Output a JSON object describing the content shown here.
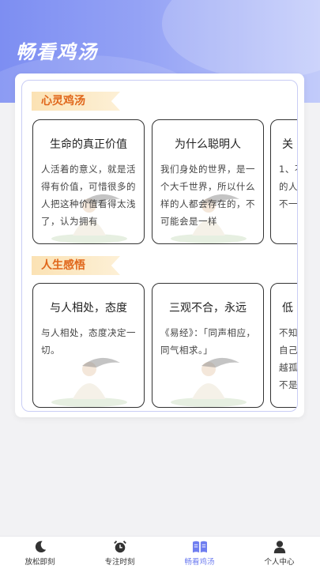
{
  "page": {
    "title": "畅看鸡汤"
  },
  "sections": [
    {
      "tag": "心灵鸡汤",
      "cards": [
        {
          "title": "生命的真正价值",
          "body": "人活着的意义，就是活得有价值，可惜很多的人把这种价值看得太浅了，认为拥有"
        },
        {
          "title": "为什么聪明人",
          "body": "我们身处的世界，是一个大千世界，所以什么样的人都会存在的，不可能会是一样"
        },
        {
          "title": "关",
          "body": "1、不\n的人\n不一"
        }
      ]
    },
    {
      "tag": "人生感悟",
      "cards": [
        {
          "title": "与人相处，态度",
          "body": "与人相处，态度决定一切。"
        },
        {
          "title": "三观不合，永远",
          "body": "《易经》：「同声相应，同气相求。」"
        },
        {
          "title": "低",
          "body": "不知\n自己\n越孤\n不是"
        }
      ]
    }
  ],
  "tabbar": {
    "items": [
      {
        "label": "放松即刻",
        "icon": "moon-icon"
      },
      {
        "label": "专注时刻",
        "icon": "alarm-clock-icon"
      },
      {
        "label": "畅看鸡汤",
        "icon": "book-icon"
      },
      {
        "label": "个人中心",
        "icon": "person-icon"
      }
    ],
    "active_index": 2
  },
  "colors": {
    "header_gradient": [
      "#7d8ef2",
      "#c2cbfa"
    ],
    "tag_text": "#e0661a",
    "active_tab": "#6f7ef0"
  }
}
